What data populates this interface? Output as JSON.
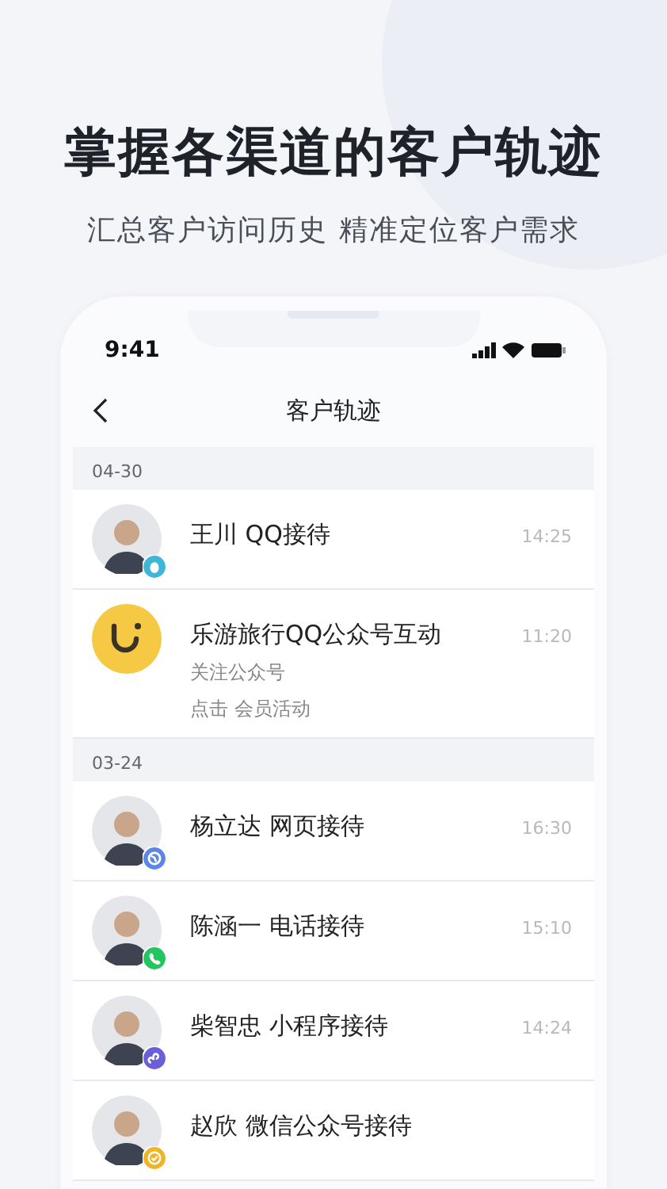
{
  "headline": "掌握各渠道的客户轨迹",
  "subtitle": "汇总客户访问历史 精准定位客户需求",
  "phone": {
    "status_bar": {
      "time": "9:41"
    },
    "nav": {
      "title": "客户轨迹"
    },
    "sections": [
      {
        "date": "04-30",
        "items": [
          {
            "kind": "person",
            "badge": {
              "kind": "qq"
            },
            "title": "王川 QQ接待",
            "time": "14:25"
          },
          {
            "kind": "brand",
            "title": "乐游旅行QQ公众号互动",
            "time": "11:20",
            "lines": [
              "关注公众号",
              "点击 会员活动"
            ]
          }
        ]
      },
      {
        "date": "03-24",
        "items": [
          {
            "kind": "person",
            "badge": {
              "kind": "web"
            },
            "title": "杨立达 网页接待",
            "time": "16:30"
          },
          {
            "kind": "person",
            "badge": {
              "kind": "phone"
            },
            "title": "陈涵一 电话接待",
            "time": "15:10"
          },
          {
            "kind": "person",
            "badge": {
              "kind": "miniapp"
            },
            "title": "柴智忠 小程序接待",
            "time": "14:24"
          },
          {
            "kind": "person",
            "badge": {
              "kind": "wechat"
            },
            "title": "赵欣 微信公众号接待"
          }
        ]
      }
    ]
  }
}
